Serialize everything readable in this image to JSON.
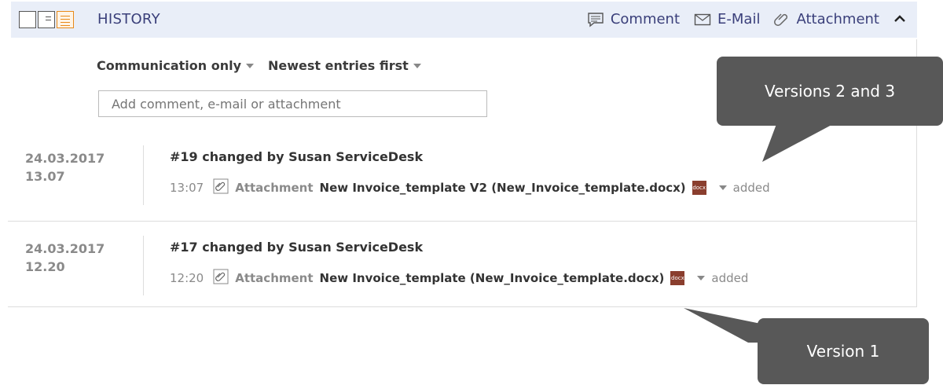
{
  "header": {
    "title": "HISTORY",
    "actions": [
      {
        "label": "Comment",
        "icon": "comment-icon"
      },
      {
        "label": "E-Mail",
        "icon": "mail-icon"
      },
      {
        "label": "Attachment",
        "icon": "paperclip-icon"
      }
    ],
    "collapse_icon": "chevron-up-icon"
  },
  "filters": {
    "filter1": "Communication only",
    "filter2": "Newest entries first"
  },
  "comment_input": {
    "placeholder": "Add comment, e-mail or attachment"
  },
  "entries": [
    {
      "date": "24.03.2017",
      "time": "13.07",
      "title": "#19 changed by Susan ServiceDesk",
      "detail_time": "13:07",
      "kind": "Attachment",
      "name": "New Invoice_template V2 (New_Invoice_template.docx)",
      "file_badge": "docx",
      "status": "added"
    },
    {
      "date": "24.03.2017",
      "time": "12.20",
      "title": "#17 changed by Susan ServiceDesk",
      "detail_time": "12:20",
      "kind": "Attachment",
      "name": "New Invoice_template (New_Invoice_template.docx)",
      "file_badge": "docx",
      "status": "added"
    }
  ],
  "callouts": {
    "versions_2_3": "Versions 2 and 3",
    "version_1": "Version 1"
  },
  "colors": {
    "header_bg": "#e9eef8",
    "header_text": "#3a3f7a",
    "active_view": "#e88a1a",
    "docx_badge": "#8a3e2e",
    "callout_bg": "#585858"
  }
}
